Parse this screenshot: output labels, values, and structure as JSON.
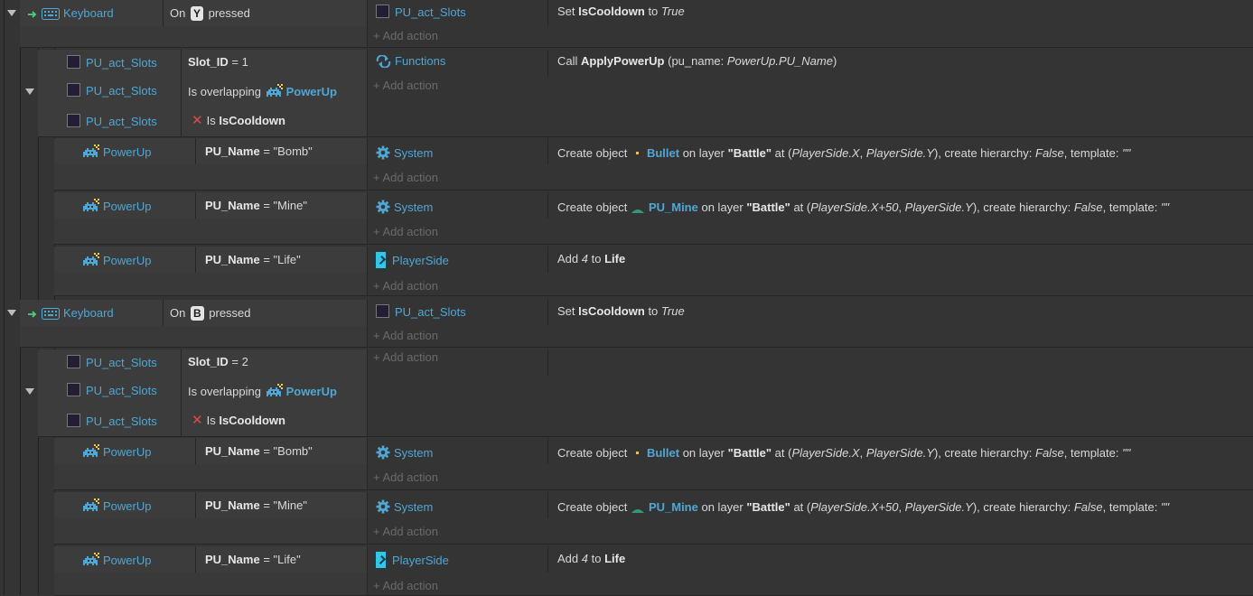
{
  "colors": {
    "background": "#343434",
    "row": "#3c3c3c",
    "object_link": "#4ea7d4",
    "add_action": "#6a6a6a",
    "keyboard_arrow": "#4cd07c"
  },
  "icons": {
    "trigger": "green-arrow-icon",
    "keyboard": "keyboard-icon",
    "sprite": "space-invader-icon",
    "system": "gear-icon",
    "functions": "cycle-arrows-icon",
    "invert": "red-x-icon"
  },
  "common": {
    "add_action": "Add action",
    "keyboard": "Keyboard",
    "on": "On",
    "pressed": "pressed",
    "is_overlapping": "Is overlapping",
    "is": "Is",
    "system": "System",
    "functions": "Functions",
    "playerside": "PlayerSide",
    "powerup": "PowerUp",
    "pu_act_slots": "PU_act_Slots",
    "pu_name": "PU_Name",
    "slot_id": "Slot_ID",
    "is_cooldown": "IsCooldown",
    "eq": "=",
    "set": "Set",
    "to": "to",
    "true": "True",
    "call": "Call",
    "apply_powerup": "ApplyPowerUp",
    "call_args_open": "(pu_name: ",
    "call_args_value": "PowerUp.PU_Name",
    "call_args_close": ")",
    "create_object": "Create object",
    "bullet": "Bullet",
    "pu_mine": "PU_Mine",
    "on_layer": "on layer",
    "battle": "\"Battle\"",
    "at": "at (",
    "px": "PlayerSide.X",
    "pxp": "PlayerSide.X+50",
    "comma": ", ",
    "py": "PlayerSide.Y",
    "create_hierarchy": "), create hierarchy: ",
    "false": "False",
    "template": ", template: ",
    "empty": "\"\"",
    "add": "Add",
    "four": "4",
    "life": "Life"
  },
  "events": [
    {
      "key": "Y",
      "slot_value": "1",
      "subevents": [
        {
          "pu_value": "\"Bomb\"",
          "action": "bullet"
        },
        {
          "pu_value": "\"Mine\"",
          "action": "mine"
        },
        {
          "pu_value": "\"Life\"",
          "action": "life"
        }
      ]
    },
    {
      "key": "B",
      "slot_value": "2",
      "subevents": [
        {
          "pu_value": "\"Bomb\"",
          "action": "bullet"
        },
        {
          "pu_value": "\"Mine\"",
          "action": "mine"
        },
        {
          "pu_value": "\"Life\"",
          "action": "life"
        }
      ]
    }
  ]
}
